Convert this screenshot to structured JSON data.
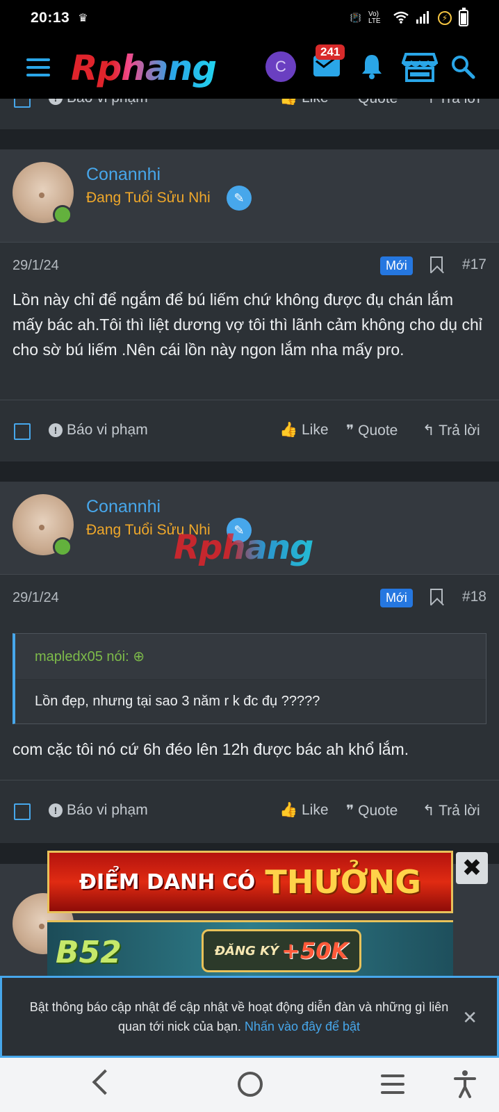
{
  "status_bar": {
    "time": "20:13",
    "net_label": "Vo) LTE"
  },
  "header": {
    "logo": "Rphang",
    "avatar_letter": "C",
    "inbox_count": "241"
  },
  "prev_post": {
    "report": "Báo vi phạm",
    "like": "Like",
    "quote": "Quote",
    "reply": "Trả lời"
  },
  "posts": [
    {
      "username": "Conannhi",
      "user_title": "Đang Tuổi Sửu Nhi",
      "date": "29/1/24",
      "new_badge": "Mới",
      "post_number": "#17",
      "body": "Lồn này chỉ để ngắm để bú liếm chứ không được đụ chán lắm mấy bác ah.Tôi thì liệt dương vợ tôi thì lãnh cảm không cho dụ chỉ cho sờ bú liếm .Nên cái lồn này ngon lắm nha mấy pro.",
      "report": "Báo vi phạm",
      "like": "Like",
      "quote": "Quote",
      "reply": "Trả lời"
    },
    {
      "username": "Conannhi",
      "user_title": "Đang Tuổi Sửu Nhi",
      "date": "29/1/24",
      "new_badge": "Mới",
      "post_number": "#18",
      "quote_author": "mapledx05 nói:",
      "quote_text": "Lồn đẹp, nhưng tại sao 3 năm r k đc đụ ?????",
      "body": "com cặc tôi nó cứ 6h đéo lên 12h được bác ah khổ lắm.",
      "report": "Báo vi phạm",
      "like": "Like",
      "quote": "Quote",
      "reply": "Trả lời"
    }
  ],
  "watermark": "Rphang",
  "ads": {
    "banner1_a": "ĐIỂM DANH CÓ",
    "banner1_b": "THƯỞNG",
    "banner2_brand": "B52",
    "banner2_cta_a": "ĐĂNG KÝ",
    "banner2_cta_b": "+50K"
  },
  "notification": {
    "text": "Bật thông báo cập nhật để cập nhật về hoạt động diễn đàn và những gì liên quan tới nick của bạn.",
    "link": "Nhấn vào đây để bật"
  }
}
